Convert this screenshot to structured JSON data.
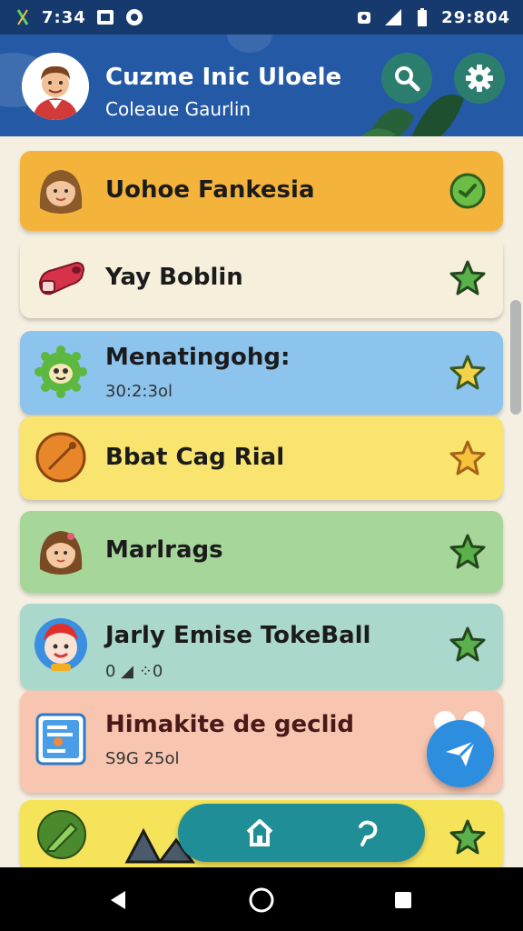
{
  "status_bar": {
    "time_left": "7:34",
    "time_right": "29:804"
  },
  "header": {
    "title": "Cuzme Inic Uloele",
    "subtitle": "Coleaue Gaurlin",
    "search_icon": "search-icon",
    "settings_icon": "gear-icon"
  },
  "items": [
    {
      "title": "Uohoe Fankesia",
      "subtitle": "",
      "bg": "#f4b43c",
      "icon": "girl-avatar-icon",
      "action": "check-circle-icon"
    },
    {
      "title": "Yay Boblin",
      "subtitle": "",
      "bg": "#f6efdc",
      "icon": "sock-icon",
      "action": "star-icon"
    },
    {
      "title": "Menatingohg:",
      "subtitle": "30:2:3ol",
      "bg": "#8cc4ee",
      "icon": "green-monster-icon",
      "action": "star-icon"
    },
    {
      "title": "Bbat Cag Rial",
      "subtitle": "",
      "bg": "#f8e46e",
      "icon": "orange-ball-icon",
      "action": "star-outline-icon"
    },
    {
      "title": "Marlrags",
      "subtitle": "",
      "bg": "#a6d69a",
      "icon": "woman-avatar-icon",
      "action": "star-icon"
    },
    {
      "title": "Jarly Emise TokeBall",
      "subtitle": "0 ◢ ⁘0",
      "bg": "#abd8cc",
      "icon": "clown-avatar-icon",
      "action": "star-icon"
    },
    {
      "title": "Himakite de geclid",
      "subtitle": "S9G 25ol",
      "bg": "#f8c6b0",
      "icon": "document-icon",
      "action": ""
    },
    {
      "title": "",
      "subtitle": "",
      "bg": "#f5e35a",
      "icon": "pencil-icon",
      "action": "star-icon"
    }
  ],
  "bottom_bar": {
    "home_icon": "home-icon",
    "refresh_icon": "refresh-icon"
  },
  "fab": {
    "icon": "send-icon"
  },
  "nav": {
    "back": "back-icon",
    "home": "home-circle-icon",
    "recents": "recents-icon"
  }
}
